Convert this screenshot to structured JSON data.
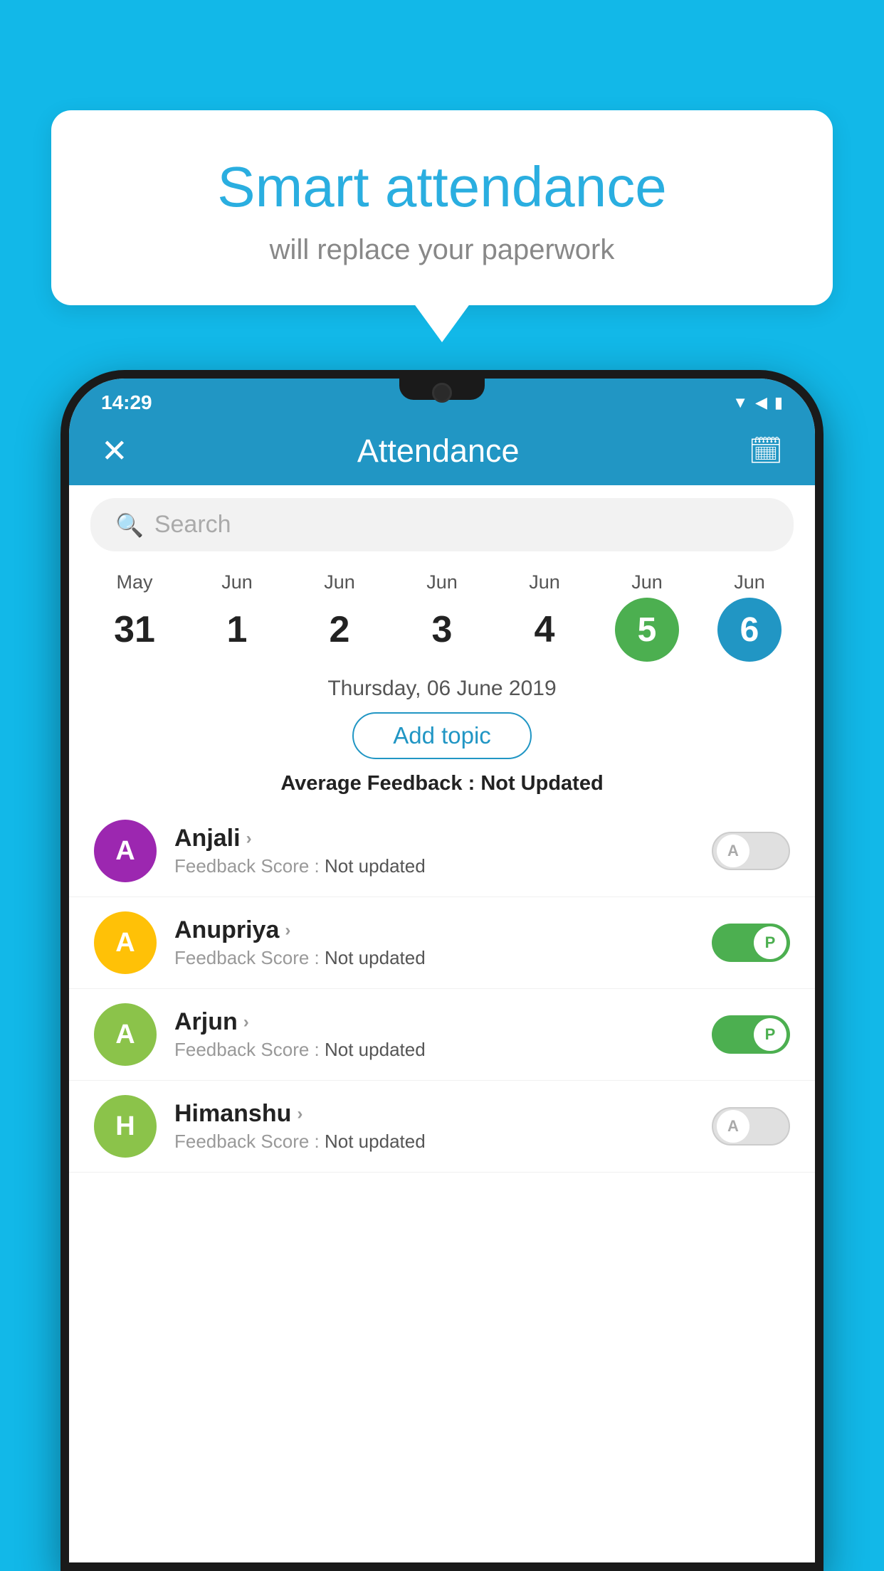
{
  "background": {
    "color": "#12B8E8"
  },
  "bubble": {
    "title": "Smart attendance",
    "subtitle": "will replace your paperwork"
  },
  "status_bar": {
    "time": "14:29",
    "wifi": "▼",
    "signal": "▲",
    "battery": "▮"
  },
  "header": {
    "close_label": "✕",
    "title": "Attendance",
    "calendar_icon": "📅"
  },
  "search": {
    "placeholder": "Search"
  },
  "calendar": {
    "days": [
      {
        "month": "May",
        "day": "31",
        "style": "normal"
      },
      {
        "month": "Jun",
        "day": "1",
        "style": "normal"
      },
      {
        "month": "Jun",
        "day": "2",
        "style": "normal"
      },
      {
        "month": "Jun",
        "day": "3",
        "style": "normal"
      },
      {
        "month": "Jun",
        "day": "4",
        "style": "normal"
      },
      {
        "month": "Jun",
        "day": "5",
        "style": "today"
      },
      {
        "month": "Jun",
        "day": "6",
        "style": "selected"
      }
    ]
  },
  "selected_date": "Thursday, 06 June 2019",
  "add_topic_label": "Add topic",
  "avg_feedback_label": "Average Feedback : ",
  "avg_feedback_value": "Not Updated",
  "students": [
    {
      "name": "Anjali",
      "avatar_letter": "A",
      "avatar_color": "#9C27B0",
      "feedback_label": "Feedback Score : ",
      "feedback_value": "Not updated",
      "toggle": "off",
      "toggle_letter": "A"
    },
    {
      "name": "Anupriya",
      "avatar_letter": "A",
      "avatar_color": "#FFC107",
      "feedback_label": "Feedback Score : ",
      "feedback_value": "Not updated",
      "toggle": "on",
      "toggle_letter": "P"
    },
    {
      "name": "Arjun",
      "avatar_letter": "A",
      "avatar_color": "#8BC34A",
      "feedback_label": "Feedback Score : ",
      "feedback_value": "Not updated",
      "toggle": "on",
      "toggle_letter": "P"
    },
    {
      "name": "Himanshu",
      "avatar_letter": "H",
      "avatar_color": "#8BC34A",
      "feedback_label": "Feedback Score : ",
      "feedback_value": "Not updated",
      "toggle": "off",
      "toggle_letter": "A"
    }
  ]
}
